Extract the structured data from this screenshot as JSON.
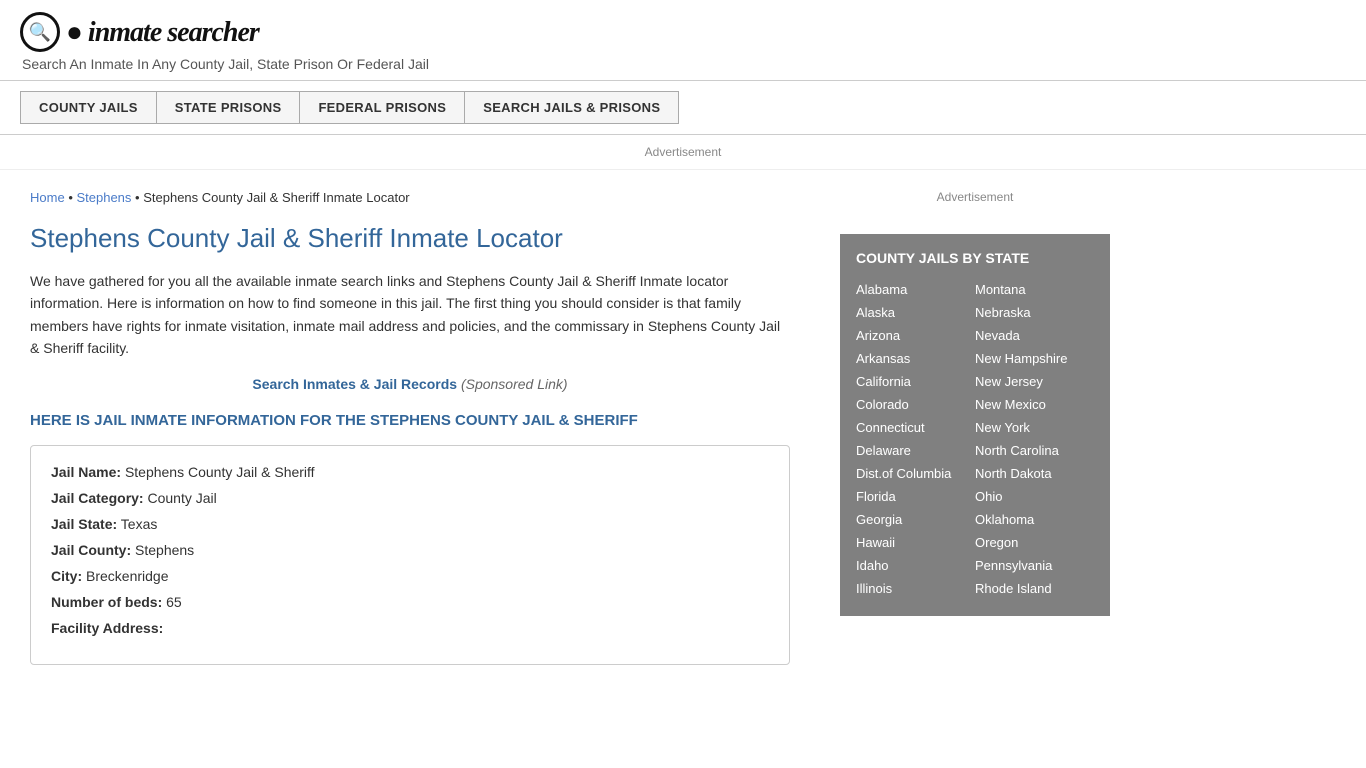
{
  "header": {
    "logo_icon": "🔍",
    "logo_text": "inmate searcher",
    "tagline": "Search An Inmate In Any County Jail, State Prison Or Federal Jail"
  },
  "nav": {
    "buttons": [
      {
        "label": "COUNTY JAILS",
        "id": "county-jails-btn"
      },
      {
        "label": "STATE PRISONS",
        "id": "state-prisons-btn"
      },
      {
        "label": "FEDERAL PRISONS",
        "id": "federal-prisons-btn"
      },
      {
        "label": "SEARCH JAILS & PRISONS",
        "id": "search-jails-btn"
      }
    ]
  },
  "ad_bar": {
    "text": "Advertisement"
  },
  "breadcrumb": {
    "home": "Home",
    "stephens": "Stephens",
    "current": "Stephens County Jail & Sheriff Inmate Locator"
  },
  "page": {
    "title": "Stephens County Jail & Sheriff Inmate Locator",
    "description": "We have gathered for you all the available inmate search links and Stephens County Jail & Sheriff Inmate locator information. Here is information on how to find someone in this jail. The first thing you should consider is that family members have rights for inmate visitation, inmate mail address and policies, and the commissary in Stephens County Jail & Sheriff facility.",
    "search_link_text": "Search Inmates & Jail Records",
    "search_link_sponsored": "(Sponsored Link)",
    "jail_info_header": "HERE IS JAIL INMATE INFORMATION FOR THE STEPHENS COUNTY JAIL & SHERIFF"
  },
  "jail_info": {
    "name_label": "Jail Name:",
    "name_value": "Stephens County Jail & Sheriff",
    "category_label": "Jail Category:",
    "category_value": "County Jail",
    "state_label": "Jail State:",
    "state_value": "Texas",
    "county_label": "Jail County:",
    "county_value": "Stephens",
    "city_label": "City:",
    "city_value": "Breckenridge",
    "beds_label": "Number of beds:",
    "beds_value": "65",
    "address_label": "Facility Address:"
  },
  "sidebar": {
    "ad_text": "Advertisement",
    "county_jails_title": "COUNTY JAILS BY STATE",
    "states_left": [
      "Alabama",
      "Alaska",
      "Arizona",
      "Arkansas",
      "California",
      "Colorado",
      "Connecticut",
      "Delaware",
      "Dist.of Columbia",
      "Florida",
      "Georgia",
      "Hawaii",
      "Idaho",
      "Illinois"
    ],
    "states_right": [
      "Montana",
      "Nebraska",
      "Nevada",
      "New Hampshire",
      "New Jersey",
      "New Mexico",
      "New York",
      "North Carolina",
      "North Dakota",
      "Ohio",
      "Oklahoma",
      "Oregon",
      "Pennsylvania",
      "Rhode Island"
    ]
  }
}
